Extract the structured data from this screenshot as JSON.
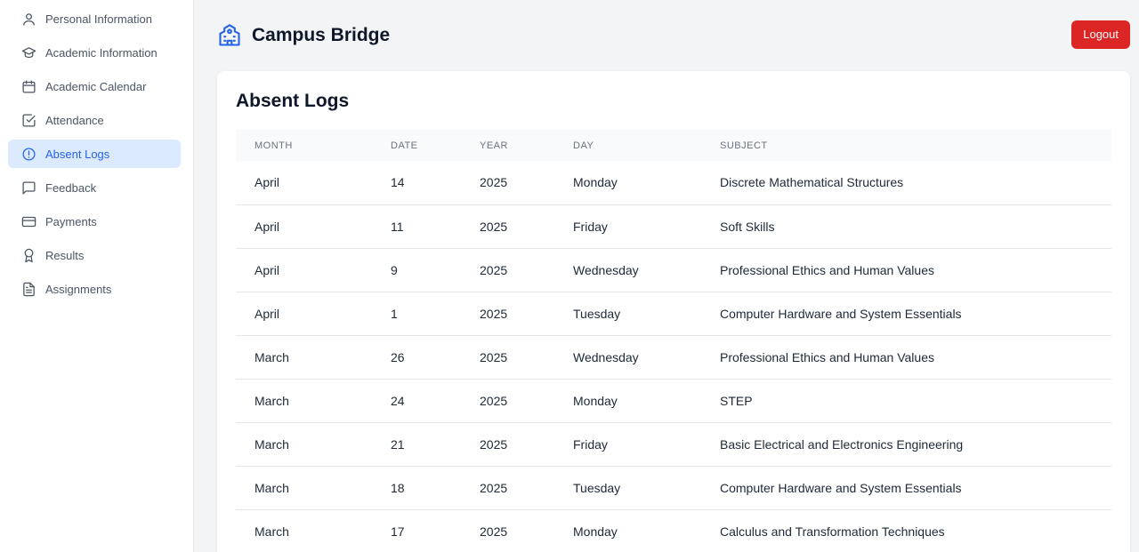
{
  "sidebar": {
    "items": [
      {
        "label": "Personal Information",
        "icon": "user-icon"
      },
      {
        "label": "Academic Information",
        "icon": "graduation-cap-icon"
      },
      {
        "label": "Academic Calendar",
        "icon": "calendar-icon"
      },
      {
        "label": "Attendance",
        "icon": "check-square-icon"
      },
      {
        "label": "Absent Logs",
        "icon": "alert-circle-icon",
        "active": true
      },
      {
        "label": "Feedback",
        "icon": "message-square-icon"
      },
      {
        "label": "Payments",
        "icon": "credit-card-icon"
      },
      {
        "label": "Results",
        "icon": "award-icon"
      },
      {
        "label": "Assignments",
        "icon": "file-text-icon"
      }
    ]
  },
  "header": {
    "app_title": "Campus Bridge",
    "logout_label": "Logout"
  },
  "colors": {
    "accent": "#2563eb",
    "active_bg": "#dbeafe",
    "logout": "#dc2626"
  },
  "absent_logs": {
    "title": "Absent Logs",
    "columns": [
      "MONTH",
      "DATE",
      "YEAR",
      "DAY",
      "SUBJECT"
    ],
    "rows": [
      [
        "April",
        "14",
        "2025",
        "Monday",
        "Discrete Mathematical Structures"
      ],
      [
        "April",
        "11",
        "2025",
        "Friday",
        "Soft Skills"
      ],
      [
        "April",
        "9",
        "2025",
        "Wednesday",
        "Professional Ethics and Human Values"
      ],
      [
        "April",
        "1",
        "2025",
        "Tuesday",
        "Computer Hardware and System Essentials"
      ],
      [
        "March",
        "26",
        "2025",
        "Wednesday",
        "Professional Ethics and Human Values"
      ],
      [
        "March",
        "24",
        "2025",
        "Monday",
        "STEP"
      ],
      [
        "March",
        "21",
        "2025",
        "Friday",
        "Basic Electrical and Electronics Engineering"
      ],
      [
        "March",
        "18",
        "2025",
        "Tuesday",
        "Computer Hardware and System Essentials"
      ],
      [
        "March",
        "17",
        "2025",
        "Monday",
        "Calculus and Transformation Techniques"
      ]
    ]
  }
}
